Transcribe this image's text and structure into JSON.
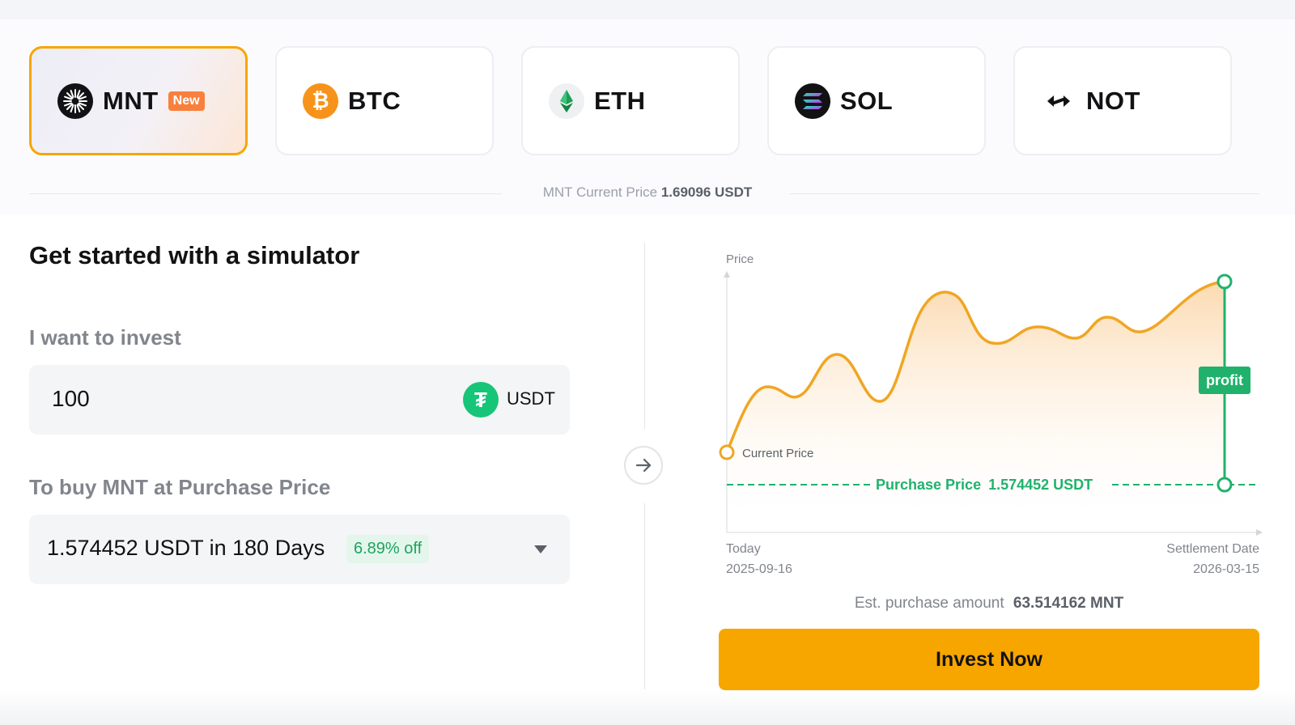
{
  "coins": [
    {
      "name": "MNT",
      "badge": "New",
      "active": true
    },
    {
      "name": "BTC",
      "active": false
    },
    {
      "name": "ETH",
      "active": false
    },
    {
      "name": "SOL",
      "active": false
    },
    {
      "name": "NOT",
      "active": false
    }
  ],
  "price_info": {
    "label": "MNT Current Price",
    "value": "1.69096 USDT"
  },
  "simulator": {
    "title": "Get started with a simulator",
    "invest_label": "I want to invest",
    "invest_value": "100",
    "invest_currency": "USDT",
    "buy_label": "To buy MNT at Purchase Price",
    "selected_option": "1.574452 USDT in 180 Days",
    "discount": "6.89% off"
  },
  "chart": {
    "y_label": "Price",
    "current_price_label": "Current Price",
    "profit_label": "profit",
    "purchase_price_label": "Purchase Price",
    "purchase_price_value": "1.574452 USDT",
    "start_label": "Today",
    "start_date": "2025-09-16",
    "end_label": "Settlement Date",
    "end_date": "2026-03-15"
  },
  "estimate": {
    "label": "Est. purchase amount",
    "value": "63.514162 MNT"
  },
  "cta_label": "Invest Now",
  "colors": {
    "accent": "#f7a600",
    "profit": "#20b26c",
    "badge_new": "#f8803d",
    "usdt": "#17c579"
  }
}
